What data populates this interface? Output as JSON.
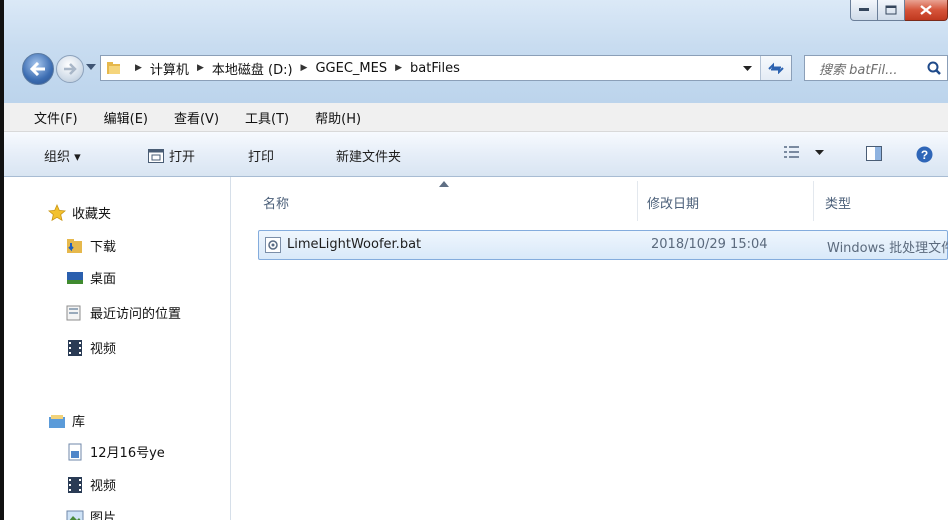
{
  "breadcrumb": [
    "计算机",
    "本地磁盘 (D:)",
    "GGEC_MES",
    "batFiles"
  ],
  "search": {
    "placeholder": "搜索 batFil..."
  },
  "menu": [
    "文件(F)",
    "编辑(E)",
    "查看(V)",
    "工具(T)",
    "帮助(H)"
  ],
  "toolbar": {
    "organize": "组织 ▾",
    "open": "打开",
    "print": "打印",
    "new_folder": "新建文件夹"
  },
  "nav": {
    "favorites": "收藏夹",
    "downloads": "下载",
    "desktop": "桌面",
    "recent": "最近访问的位置",
    "videos_fav": "视频",
    "libraries": "库",
    "lib_custom": "12月16号ye",
    "lib_videos": "视频",
    "lib_pictures": "图片"
  },
  "columns": {
    "name": "名称",
    "date": "修改日期",
    "type": "类型"
  },
  "files": [
    {
      "name": "LimeLightWoofer.bat",
      "date": "2018/10/29 15:04",
      "type": "Windows 批处理文件"
    }
  ],
  "colors": {
    "accent": "#3c6db2",
    "close": "#c0391f",
    "selection_border": "#84acdd"
  }
}
